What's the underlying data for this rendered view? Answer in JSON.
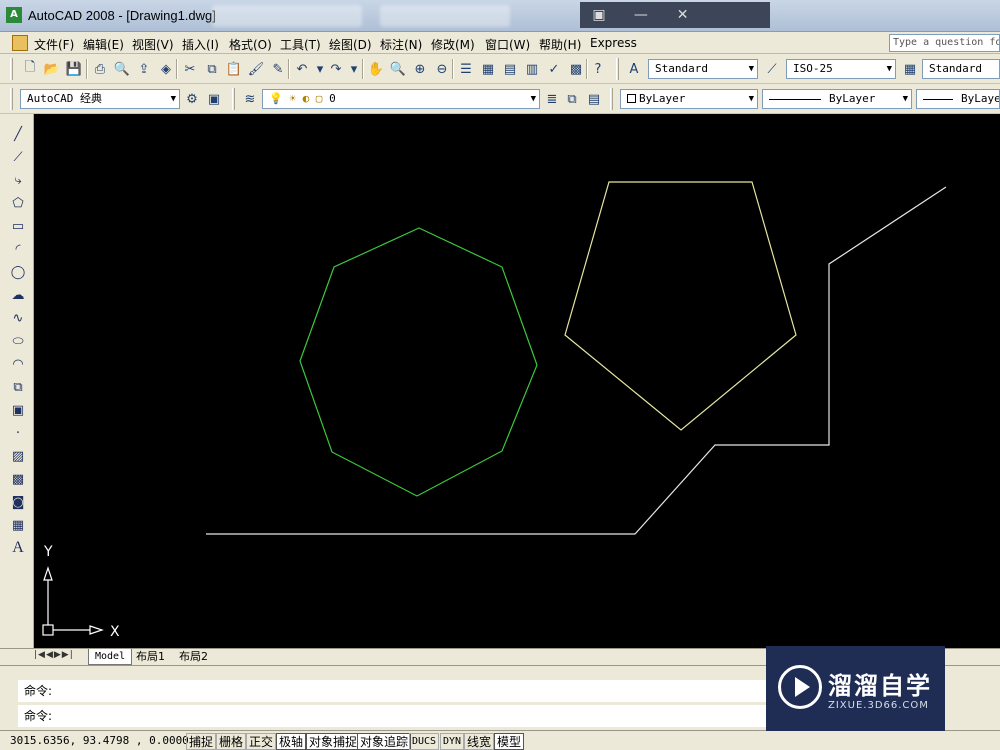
{
  "window": {
    "title": "AutoCAD 2008 - [Drawing1.dwg]"
  },
  "menu": {
    "items": [
      "文件(F)",
      "编辑(E)",
      "视图(V)",
      "插入(I)",
      "格式(O)",
      "工具(T)",
      "绘图(D)",
      "标注(N)",
      "修改(M)",
      "窗口(W)",
      "帮助(H)",
      "Express"
    ],
    "help_placeholder": "Type a question for"
  },
  "toolbar_styles": {
    "text_style": "Standard",
    "dim_style": "ISO-25",
    "table_style": "Standard"
  },
  "toolbar_layers": {
    "workspace": "AutoCAD 经典",
    "layer": "0",
    "color": "ByLayer",
    "linetype": "ByLayer",
    "lineweight": "ByLayer"
  },
  "ucs": {
    "x_label": "X",
    "y_label": "Y"
  },
  "drawing": {
    "octagon_color": "#3cc83c",
    "pentagon_color": "#e6e6a0",
    "polyline_color": "#e6e6e6"
  },
  "layout_tabs": [
    "Model",
    "布局1",
    "布局2"
  ],
  "command": {
    "line1": "命令:",
    "line2": "命令:"
  },
  "status": {
    "coords": "3015.6356, 93.4798 , 0.0000",
    "buttons": [
      "捕捉",
      "栅格",
      "正交",
      "极轴",
      "对象捕捉",
      "对象追踪",
      "DUCS",
      "DYN",
      "线宽",
      "模型"
    ]
  },
  "watermark": {
    "brand_cn": "溜溜自学",
    "brand_en": "ZIXUE.3D66.COM"
  }
}
